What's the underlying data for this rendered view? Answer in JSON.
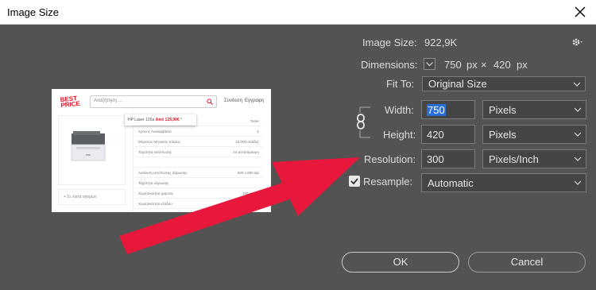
{
  "window": {
    "title": "Image Size"
  },
  "info": {
    "image_size_label": "Image Size:",
    "image_size_value": "922,9K",
    "dimensions_label": "Dimensions:",
    "dim_width": "750",
    "dim_width_unit": "px",
    "dim_times": "×",
    "dim_height": "420",
    "dim_height_unit": "px"
  },
  "fit_to": {
    "label": "Fit To:",
    "value": "Original Size"
  },
  "width": {
    "label": "Width:",
    "value": "750",
    "unit": "Pixels"
  },
  "height": {
    "label": "Height:",
    "value": "420",
    "unit": "Pixels"
  },
  "resolution": {
    "label": "Resolution:",
    "value": "300",
    "unit": "Pixels/Inch"
  },
  "resample": {
    "label": "Resample:",
    "value": "Automatic",
    "checked": true
  },
  "buttons": {
    "ok": "OK",
    "cancel": "Cancel"
  },
  "preview": {
    "logo_line1": "BEST",
    "logo_line2": "PRICE",
    "search_placeholder": "Αναζήτηση ...",
    "nav_1": "Συνδεση",
    "nav_2": "Εγγραφη",
    "popup_text": "HP Laser 135a",
    "popup_price": "Από 129,90€",
    "popup_chevron": "^",
    "bottom_link": "+ Σε λίστα αγορών",
    "rows": [
      {
        "k": "",
        "v": "Toner"
      },
      {
        "k": "Χρόνος Αναλαμβάνει",
        "v": "1"
      },
      {
        "k": "Μέγιστος Μηνιαίος Κύκλος",
        "v": "10.000 σελίδες"
      },
      {
        "k": "Ταχύτητα εκτύπωσης",
        "v": "Α4 ασπρόμαυρη"
      },
      {
        "k": "",
        "v": ""
      },
      {
        "k": "Ανάλυση εκτύπωσης σάρωσης",
        "v": "600 x 600 dpi"
      },
      {
        "k": "Ταχύτητα σάρωσης",
        "v": ""
      },
      {
        "k": "Χωρητικότητα χαρτιού",
        "v": "150 φύλλα"
      },
      {
        "k": "Χωρητικότητα εξόδου",
        "v": ""
      }
    ]
  },
  "colors": {
    "background": "#535353",
    "arrow": "#e8173c",
    "selection": "#2a6fd6"
  }
}
